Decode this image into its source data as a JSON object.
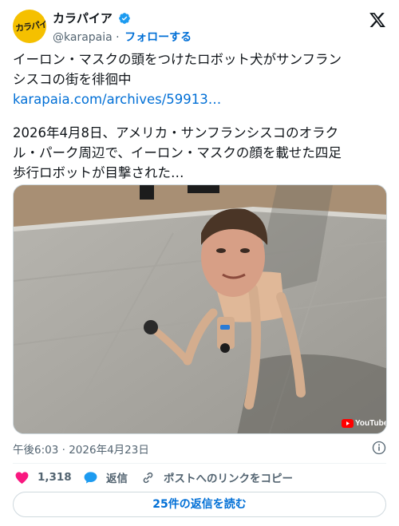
{
  "author": {
    "display_name": "カラパイア",
    "handle": "@karapaia",
    "separator": "·",
    "follow_label": "フォローする",
    "avatar_text": "カラパイア",
    "verified": true
  },
  "post": {
    "line1": "イーロン・マスクの頭をつけたロボット犬がサンフラン",
    "line2": "シスコの街を徘徊中",
    "link": "karapaia.com/archives/59913…",
    "para2_line1": "2026年4月8日、アメリカ・サンフランシスコのオラク",
    "para2_line2": "ル・パーク周辺で、イーロン・マスクの顔を載せた四足",
    "para2_line3": "歩行ロボットが目撃された…"
  },
  "media": {
    "badge": "YouTube"
  },
  "meta": {
    "time": "午後6:03",
    "separator": "·",
    "date": "2026年4月23日"
  },
  "actions": {
    "like_count": "1,318",
    "reply_label": "返信",
    "copy_link_label": "ポストへのリンクをコピー"
  },
  "read_replies_label": "25件の返信を読む",
  "colors": {
    "accent": "#006fd6",
    "like": "#f91880",
    "secondary_text": "#536471",
    "verified": "#1d9bf0"
  }
}
